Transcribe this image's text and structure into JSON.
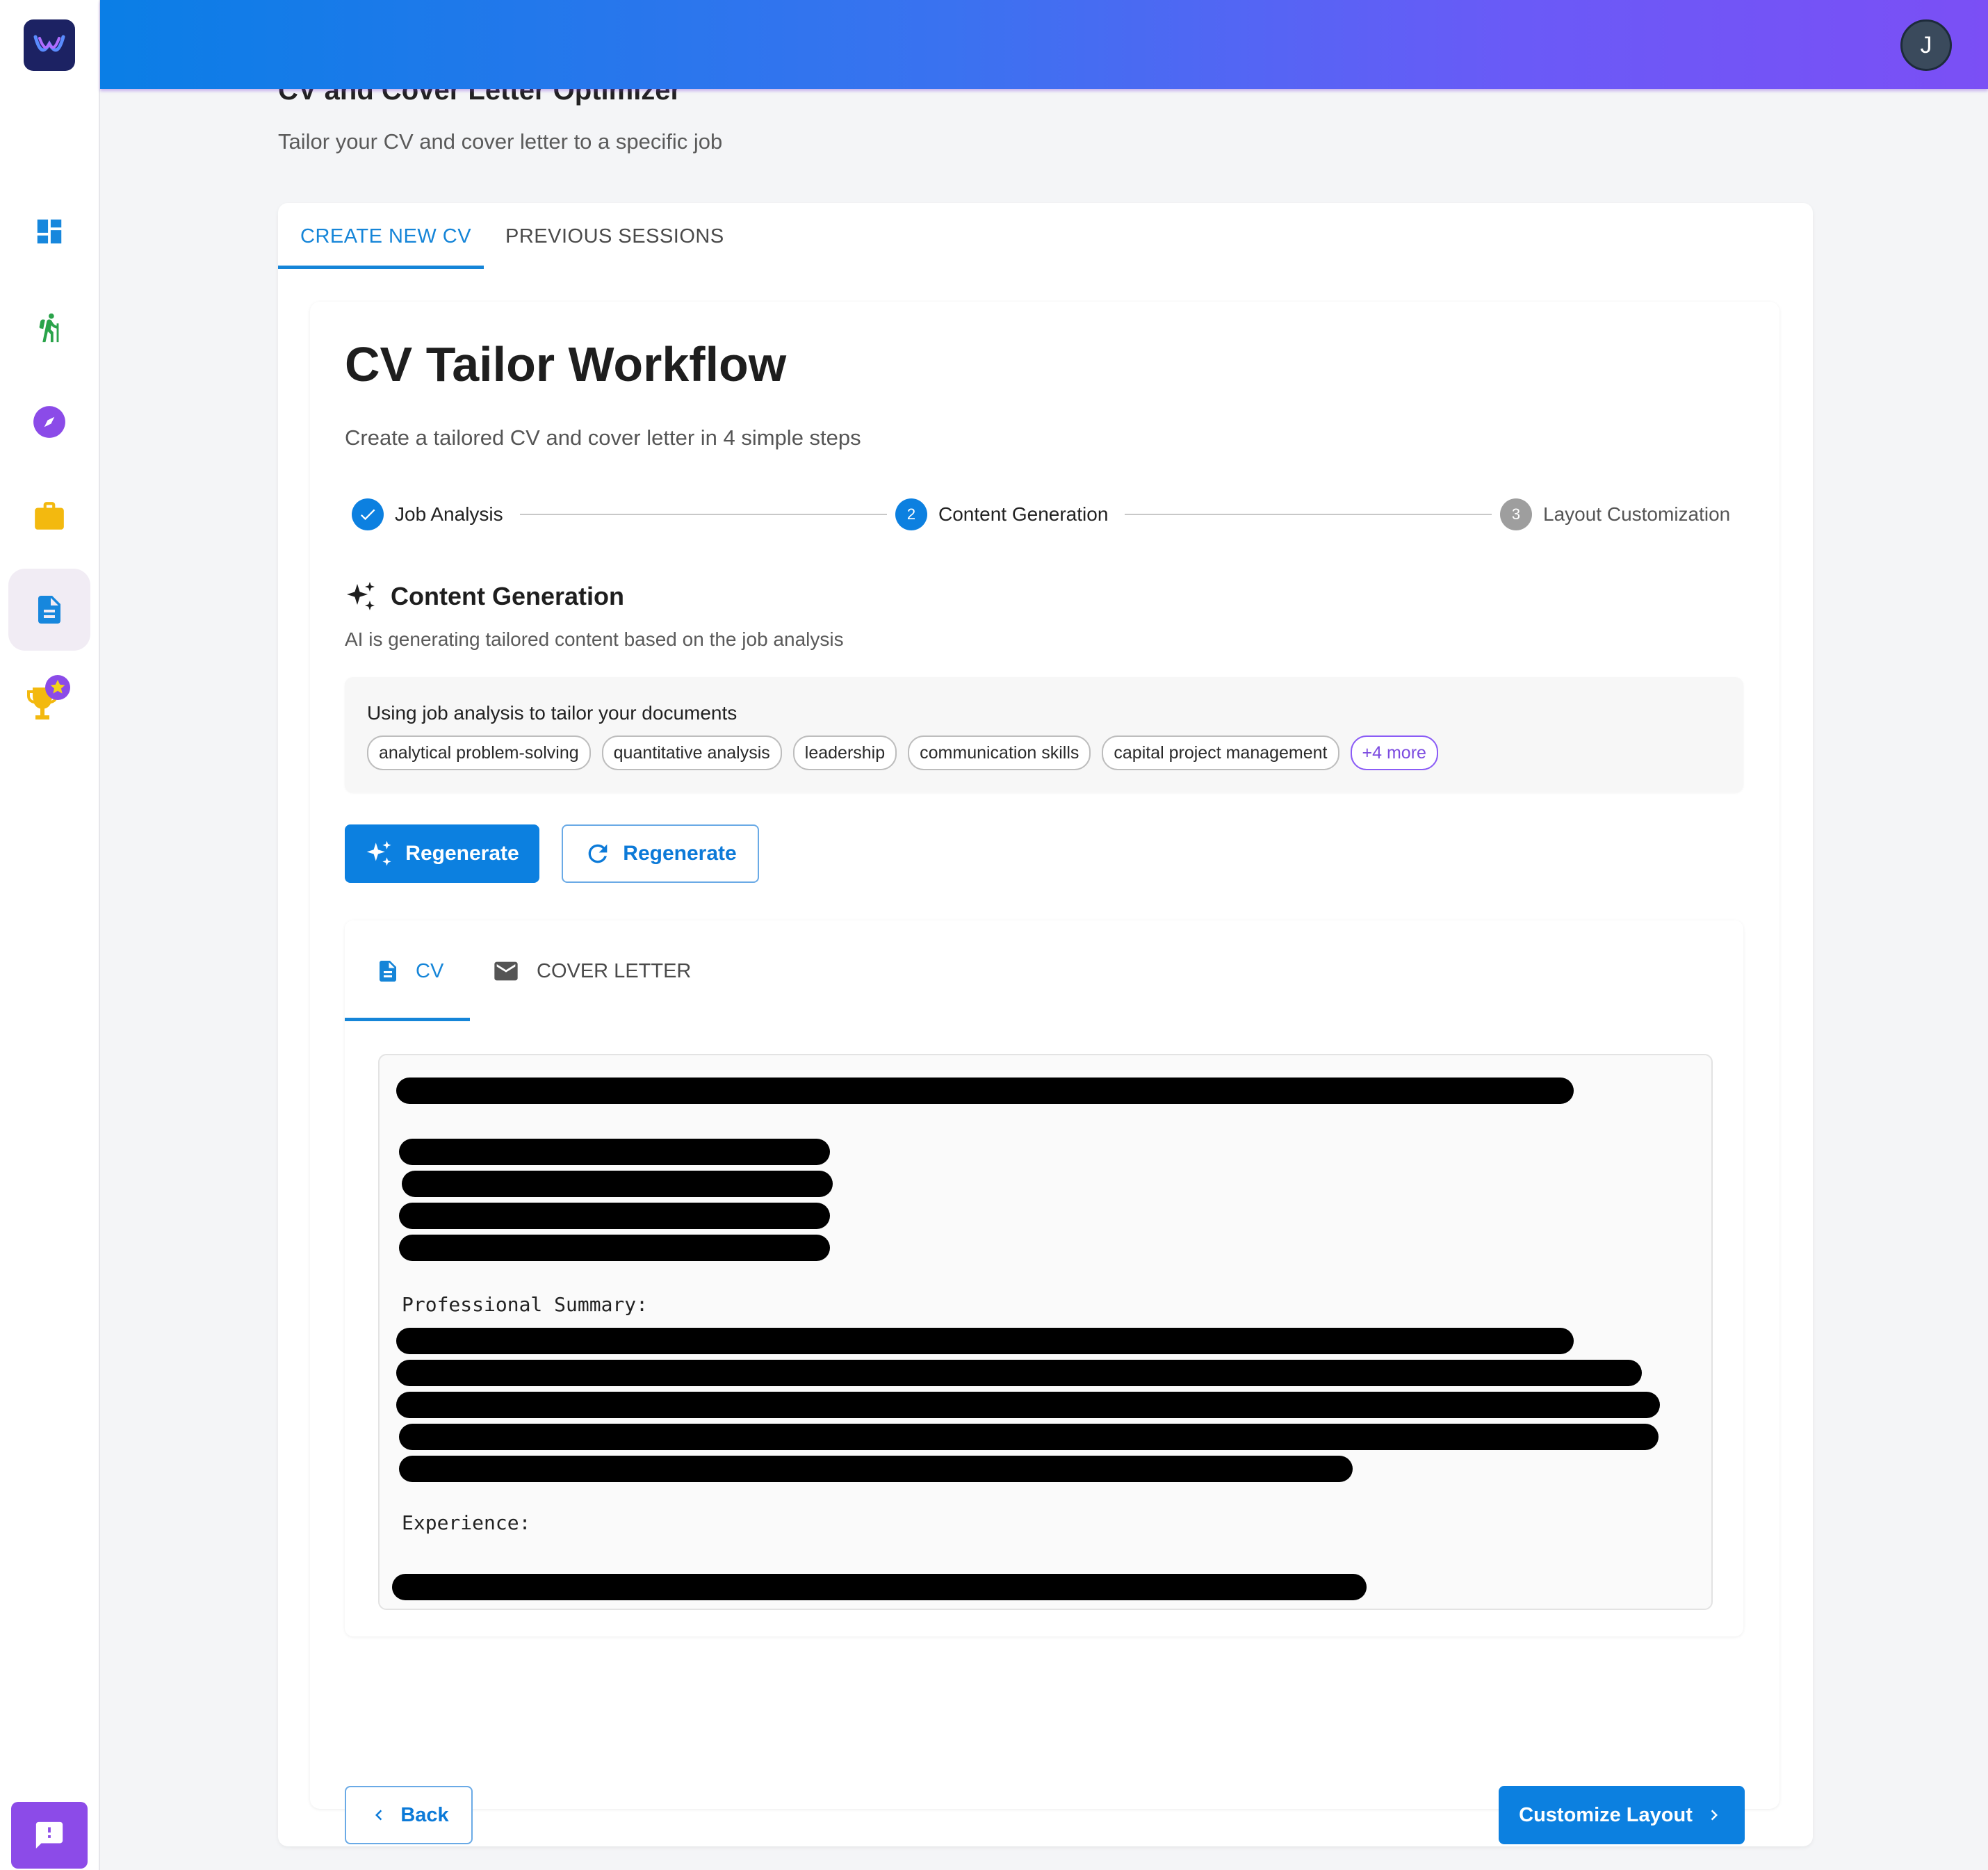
{
  "header": {
    "avatar_initial": "J"
  },
  "sidebar": {
    "items": [
      {
        "icon": "dashboard-icon",
        "color": "#1787dd"
      },
      {
        "icon": "hiking-icon",
        "color": "#2aa34a"
      },
      {
        "icon": "compass-icon",
        "color": "#8b4be8"
      },
      {
        "icon": "briefcase-icon",
        "color": "#f3b90f"
      },
      {
        "icon": "document-icon",
        "color": "#1787dd",
        "active": true
      },
      {
        "icon": "trophy-icon",
        "color": "#f3b90f"
      }
    ],
    "feedback_icon": "feedback-icon"
  },
  "page": {
    "title": "CV and Cover Letter Optimizer",
    "subtitle": "Tailor your CV and cover letter to a specific job"
  },
  "tabs": [
    {
      "label": "CREATE NEW CV",
      "active": true
    },
    {
      "label": "PREVIOUS SESSIONS",
      "active": false
    }
  ],
  "workflow": {
    "title": "CV Tailor Workflow",
    "description": "Create a tailored CV and cover letter in 4 simple steps",
    "steps": [
      {
        "number": "1",
        "label": "Job Analysis",
        "status": "completed"
      },
      {
        "number": "2",
        "label": "Content Generation",
        "status": "active"
      },
      {
        "number": "3",
        "label": "Layout Customization",
        "status": "pending"
      }
    ]
  },
  "content_generation": {
    "title": "Content Generation",
    "description": "AI is generating tailored content based on the job analysis",
    "analysis_label": "Using job analysis to tailor your documents",
    "chips": [
      "analytical problem-solving",
      "quantitative analysis",
      "leadership",
      "communication skills",
      "capital project management"
    ],
    "more_chip": "+4 more",
    "regenerate_primary": "Regenerate",
    "regenerate_secondary": "Regenerate"
  },
  "doc_tabs": [
    {
      "label": "CV",
      "active": true
    },
    {
      "label": "COVER LETTER",
      "active": false
    }
  ],
  "document": {
    "professional_summary_label": "Professional Summary:",
    "experience_label": "Experience:"
  },
  "footer": {
    "back_label": "Back",
    "next_label": "Customize Layout"
  },
  "colors": {
    "accent": "#0c80e0",
    "header_gradient_start": "#0a7ee6",
    "header_gradient_end": "#7b4ff5",
    "step_completed": "#0c80e0",
    "step_pending": "#9e9e9e",
    "more_chip": "#8b5cf6"
  }
}
